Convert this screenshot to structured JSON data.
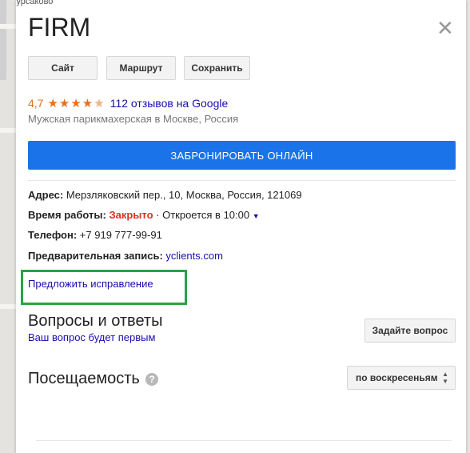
{
  "map": {
    "label": "Курсаково"
  },
  "card": {
    "title": "FIRM",
    "close_icon": "close-icon",
    "buttons": {
      "site": "Сайт",
      "route": "Маршрут",
      "save": "Сохранить"
    },
    "rating": {
      "value": "4,7",
      "stars": 4.7,
      "reviews": "112 отзывов на Google"
    },
    "subtitle": "Мужская парикмахерская в Москве, Россия",
    "book_label": "ЗАБРОНИРОВАТЬ ОНЛАЙН",
    "address": {
      "label": "Адрес:",
      "value": "Мерзляковский пер., 10, Москва, Россия, 121069"
    },
    "hours": {
      "label": "Время работы:",
      "status": "Закрыто",
      "next": "· Откроется в 10:00"
    },
    "phone": {
      "label": "Телефон:",
      "value": "+7 919 777-99-91"
    },
    "booking": {
      "label": "Предварительная запись:",
      "link": "yclients.com"
    },
    "suggest_edit": "Предложить исправление",
    "qa": {
      "title": "Вопросы и ответы",
      "subtitle": "Ваш вопрос будет первым",
      "ask_button": "Задайте вопрос"
    },
    "attendance": {
      "title": "Посещаемость",
      "help_icon": "help-icon",
      "day_select": "по воскресеньям"
    },
    "colors": {
      "accent": "#1a73e8",
      "rating": "#e7711b",
      "closed": "#d93025",
      "link": "#1a0dab",
      "highlight": "#2aa345"
    }
  }
}
